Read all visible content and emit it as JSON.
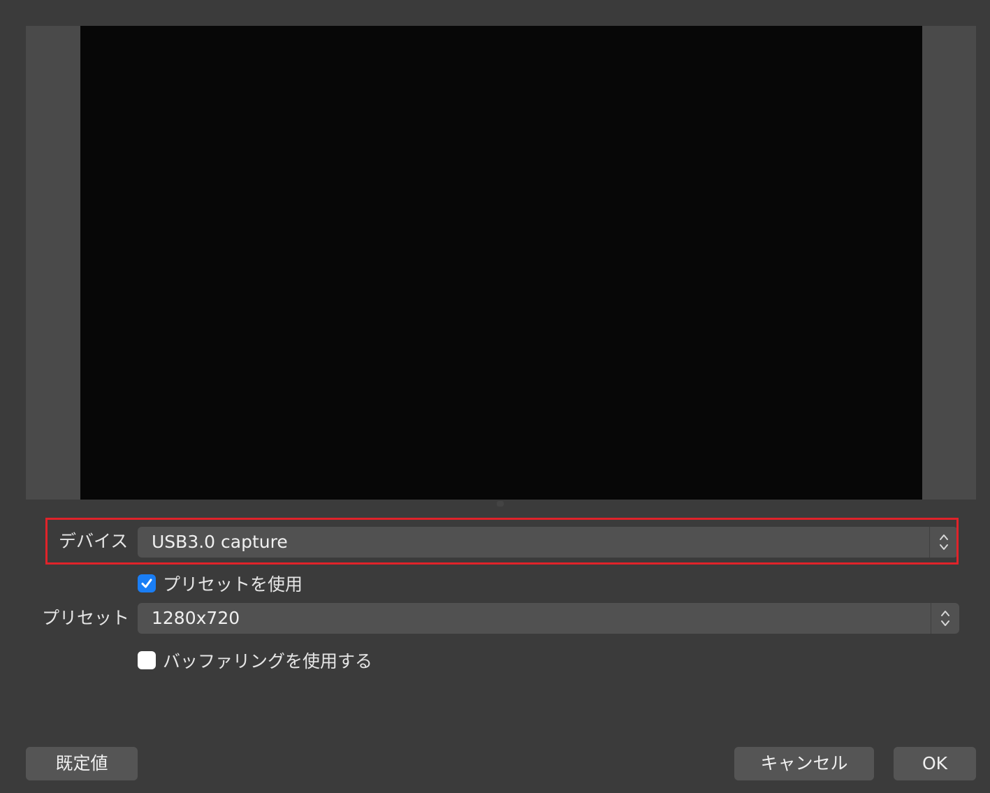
{
  "device": {
    "label": "デバイス",
    "value": "USB3.0 capture"
  },
  "use_preset": {
    "label": "プリセットを使用",
    "checked": true
  },
  "preset": {
    "label": "プリセット",
    "value": "1280x720"
  },
  "use_buffering": {
    "label": "バッファリングを使用する",
    "checked": false
  },
  "buttons": {
    "defaults": "既定値",
    "cancel": "キャンセル",
    "ok": "OK"
  },
  "colors": {
    "highlight": "#e0232a",
    "checkbox_accent": "#1a7ef5"
  }
}
